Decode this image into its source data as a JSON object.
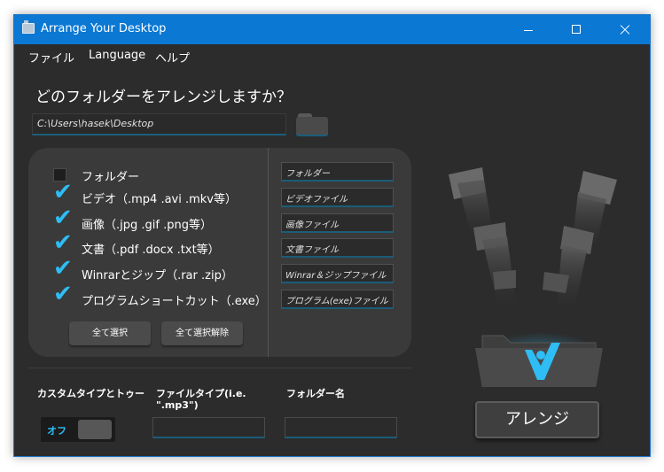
{
  "window": {
    "title": "Arrange Your Desktop",
    "accent_color": "#0b78d4",
    "controls": [
      "minimize-icon",
      "maximize-icon",
      "close-icon"
    ]
  },
  "menu": {
    "items": [
      "ファイル",
      "Language",
      "ヘルプ"
    ]
  },
  "question": "どのフォルダーをアレンジしますか？",
  "path": {
    "value": "C:\\Users\\hasek\\Desktop"
  },
  "categories": [
    {
      "label": "フォルダー",
      "checked": false,
      "folder_name": "フォルダー"
    },
    {
      "label": "ビデオ（.mp4 .avi .mkv等）",
      "checked": true,
      "folder_name": "ビデオファイル"
    },
    {
      "label": "画像（.jpg .gif .png等）",
      "checked": true,
      "folder_name": "画像ファイル"
    },
    {
      "label": "文書（.pdf .docx .txt等）",
      "checked": true,
      "folder_name": "文書ファイル"
    },
    {
      "label": "Winrarとジップ（.rar .zip）",
      "checked": true,
      "folder_name": "Winrar＆ジップファイル"
    },
    {
      "label": "プログラムショートカット（.exe）",
      "checked": true,
      "folder_name": "プログラム(exe)ファイル"
    }
  ],
  "buttons": {
    "select_all": "全て選択",
    "deselect_all": "全て選択解除",
    "arrange": "アレンジ"
  },
  "custom": {
    "label": "カスタムタイプとトゥー",
    "toggle_state": "オフ",
    "filetype_label": "ファイルタイプ(i.e. \".mp3\")",
    "filetype_value": "",
    "folder_label": "フォルダー名",
    "folder_value": ""
  },
  "colors": {
    "background": "#2c2c2c",
    "panel": "#3a3a3a",
    "check": "#2ebdf4",
    "illustration_accent": "#2ebdf4"
  }
}
